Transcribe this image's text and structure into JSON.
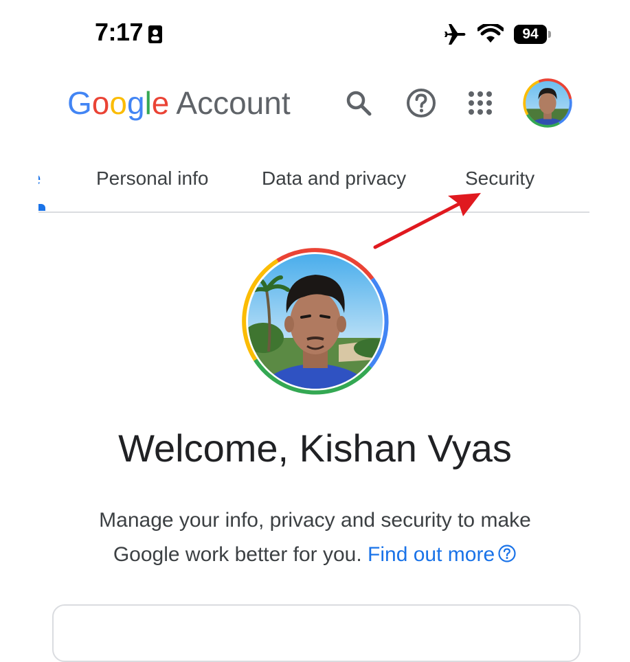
{
  "status_bar": {
    "time": "7:17",
    "battery": "94",
    "icons": [
      "badge-icon",
      "airplane-icon",
      "wifi-icon",
      "battery-icon"
    ]
  },
  "header": {
    "logo_letters": [
      "G",
      "o",
      "o",
      "g",
      "l",
      "e"
    ],
    "product": "Account",
    "colors": {
      "blue": "#4285F4",
      "red": "#EA4335",
      "yellow": "#FBBC05",
      "green": "#34A853"
    },
    "icons": [
      "search-icon",
      "help-icon",
      "apps-icon",
      "avatar"
    ]
  },
  "tabs": [
    {
      "label": "e"
    },
    {
      "label": "Personal info"
    },
    {
      "label": "Data and privacy"
    },
    {
      "label": "Security"
    }
  ],
  "profile": {
    "welcome": "Welcome, Kishan Vyas"
  },
  "intro": {
    "text": "Manage your info, privacy and security to make Google work better for you.",
    "link": "Find out more"
  },
  "accent": "#1a73e8"
}
